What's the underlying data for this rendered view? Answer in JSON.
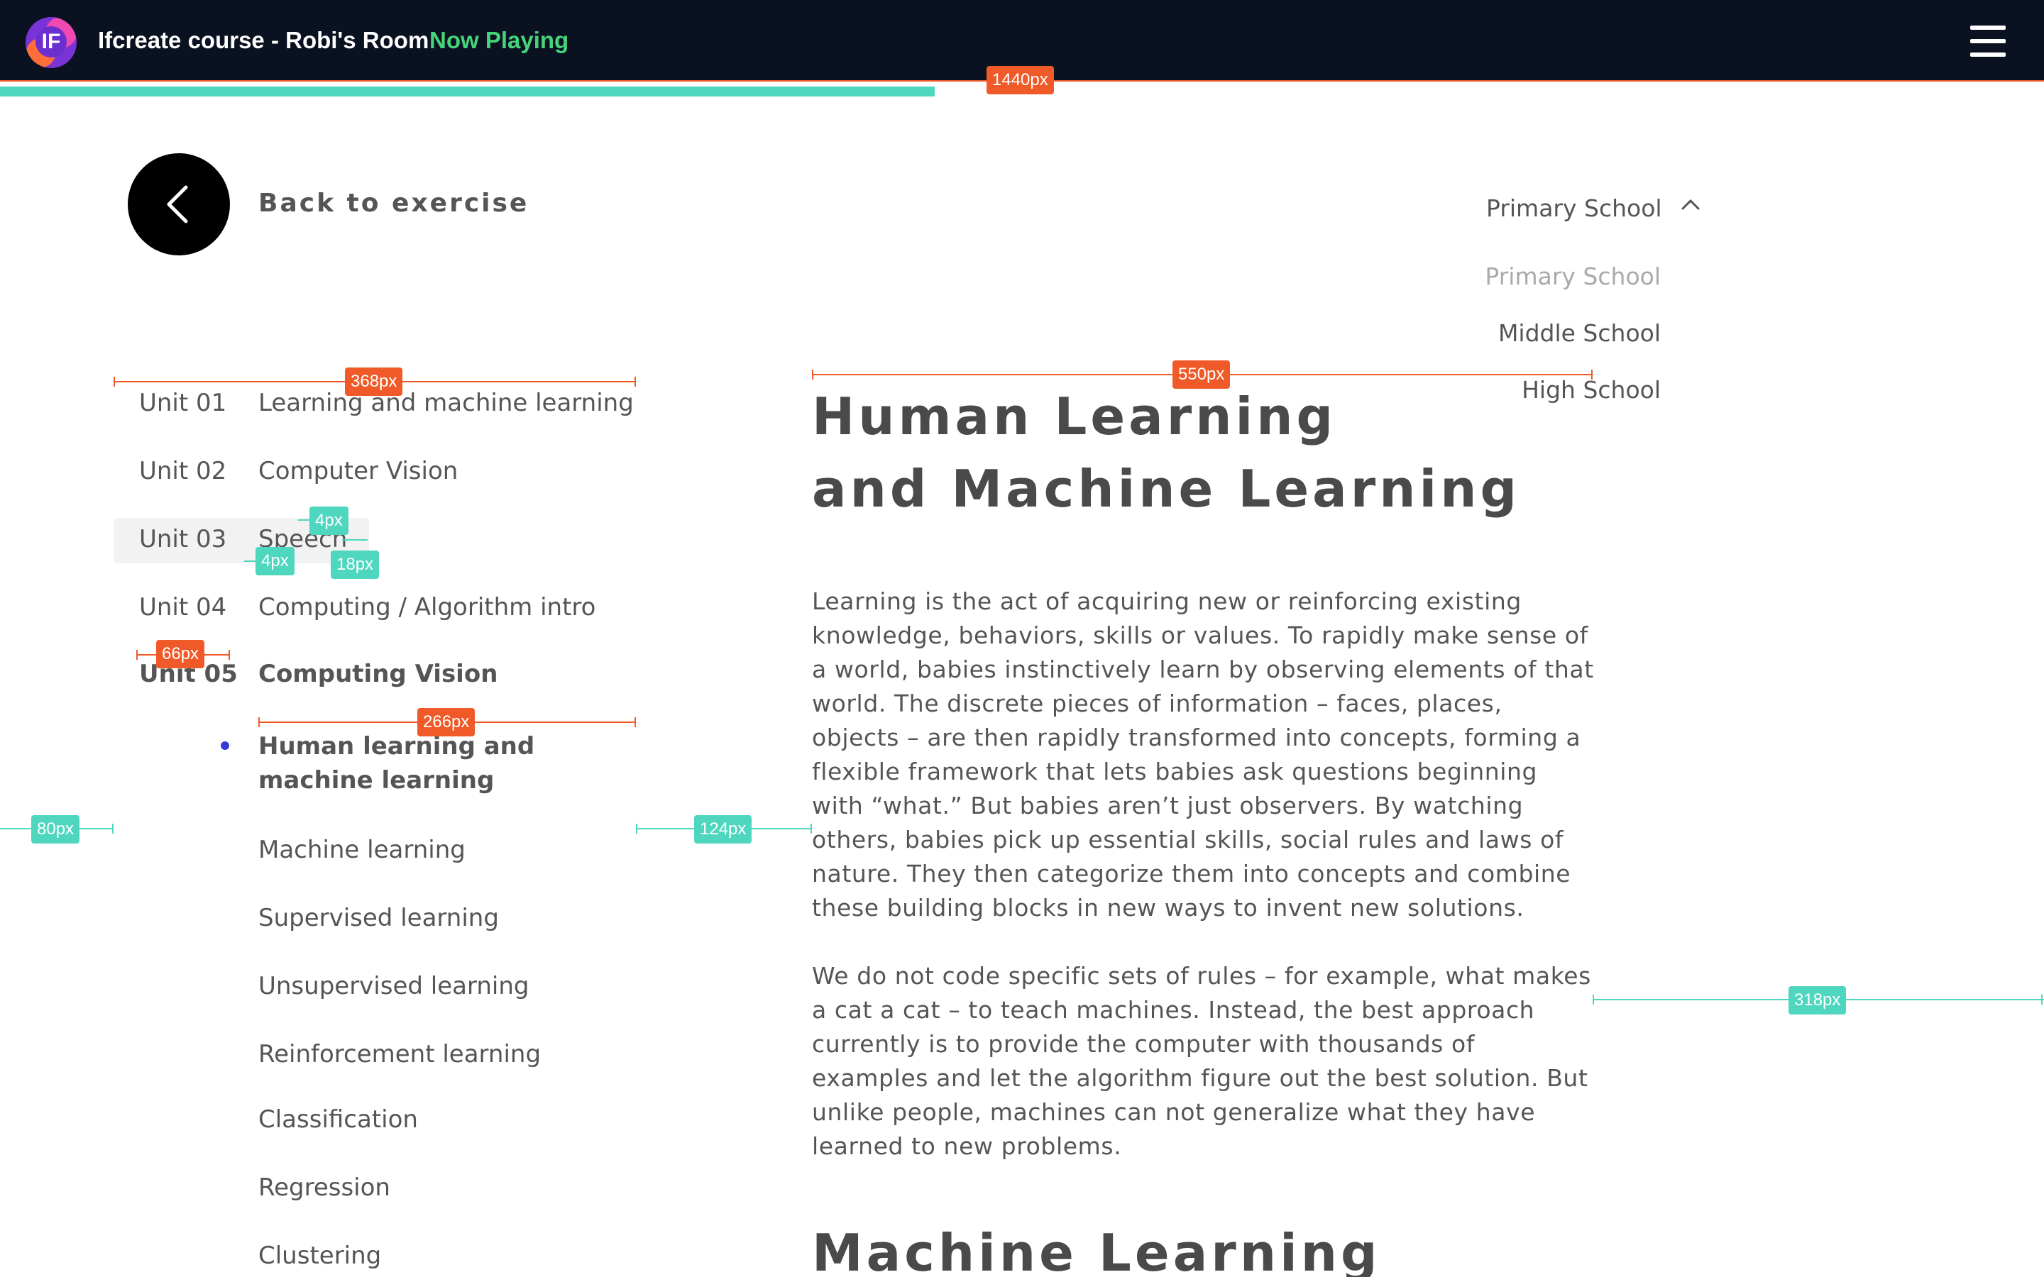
{
  "header": {
    "logo_text": "IF",
    "title": "Ifcreate course - Robi's Room",
    "status": "Now Playing",
    "status_color": "#46d37a",
    "menu_icon": "hamburger-icon"
  },
  "progress": {
    "fraction": 0.4572,
    "color": "#4fd6bf"
  },
  "back": {
    "label": "Back to exercise",
    "icon": "chevron-left-icon"
  },
  "level_select": {
    "selected": "Primary School",
    "icon": "chevron-up-icon",
    "options": [
      "Primary School",
      "Middle School",
      "High School"
    ]
  },
  "nav": {
    "units": [
      {
        "num": "Unit 01",
        "title": "Learning and machine learning"
      },
      {
        "num": "Unit 02",
        "title": "Computer Vision"
      },
      {
        "num": "Unit 03",
        "title": "Speech"
      },
      {
        "num": "Unit 04",
        "title": "Computing / Algorithm intro"
      },
      {
        "num": "Unit 05",
        "title": "Computing Vision"
      }
    ],
    "lessons": [
      "Human learning and machine learning",
      "Machine learning",
      "Supervised learning",
      "Unsupervised learning",
      "Reinforcement learning",
      "Classification",
      "Regression",
      "Clustering"
    ]
  },
  "content": {
    "title_line1": "Human Learning",
    "title_line2": "and Machine Learning",
    "paragraphs": [
      "Learning is the act of acquiring new or reinforcing existing knowledge, behaviors, skills or values. To rapidly make sense of a world, babies instinctively learn by observing elements of that world. The discrete pieces of information – faces, places, objects – are then rapidly transformed into concepts, forming a flexible framework that lets babies ask questions beginning with “what.” But babies aren’t just observers. By watching others, babies pick up essential skills, social rules and laws of nature. They then categorize them into concepts and combine these building blocks in new ways to invent new solutions.",
      "We do not code specific sets of rules – for example, what makes a cat a cat – to teach machines. Instead, the best approach currently is to provide the computer with thousands of examples and let the algorithm figure out the best solution. But unlike people, machines can not generalize what they have learned to new problems."
    ],
    "section_title": "Machine Learning"
  },
  "redlines": {
    "colors": {
      "orange": "#f05a28",
      "teal": "#4fd6bf"
    },
    "labels": [
      "1440px",
      "368px",
      "550px",
      "4px",
      "4px",
      "18px",
      "66px",
      "266px",
      "80px",
      "124px",
      "318px"
    ]
  }
}
